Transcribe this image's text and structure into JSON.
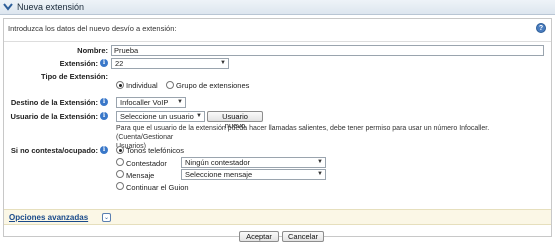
{
  "window": {
    "title": "Nueva extensión"
  },
  "intro": {
    "text": "Introduzca los datos del nuevo desvío a extensión:"
  },
  "form": {
    "nombre": {
      "label": "Nombre:",
      "value": "Prueba"
    },
    "extension": {
      "label": "Extensión:",
      "value": "22"
    },
    "tipo": {
      "label": "Tipo de Extensión:",
      "options": [
        "Individual",
        "Grupo de extensiones"
      ],
      "selected": "Individual"
    },
    "destino": {
      "label": "Destino de la Extensión:",
      "value": "Infocaller VoIP"
    },
    "usuario": {
      "label": "Usuario de la Extensión:",
      "select_value": "Seleccione un usuario",
      "new_button": "Usuario nuevo",
      "note_line1": "Para que el usuario de la extensión pueda hacer llamadas salientes, debe tener permiso para usar un número Infocaller. (Cuenta/Gestionar",
      "note_line2": "Usuarios)"
    },
    "si_no_contesta": {
      "label": "Si no contesta/ocupado:",
      "options": [
        "Tonos telefónicos",
        "Contestador",
        "Mensaje",
        "Continuar el Guion"
      ],
      "selected": "Tonos telefónicos",
      "contestador_select": "Ningún contestador",
      "mensaje_select": "Seleccione mensaje"
    }
  },
  "advanced": {
    "label": "Opciones avanzadas"
  },
  "buttons": {
    "accept": "Aceptar",
    "cancel": "Cancelar"
  },
  "colors": {
    "info_icon": "#3a78c9",
    "advanced_bg": "#fbf7e6",
    "link": "#1a4a8a"
  },
  "icons": {
    "app": "chevron-logo-icon",
    "help": "help-icon",
    "info": "info-icon",
    "expand": "double-chevron-down-icon"
  }
}
